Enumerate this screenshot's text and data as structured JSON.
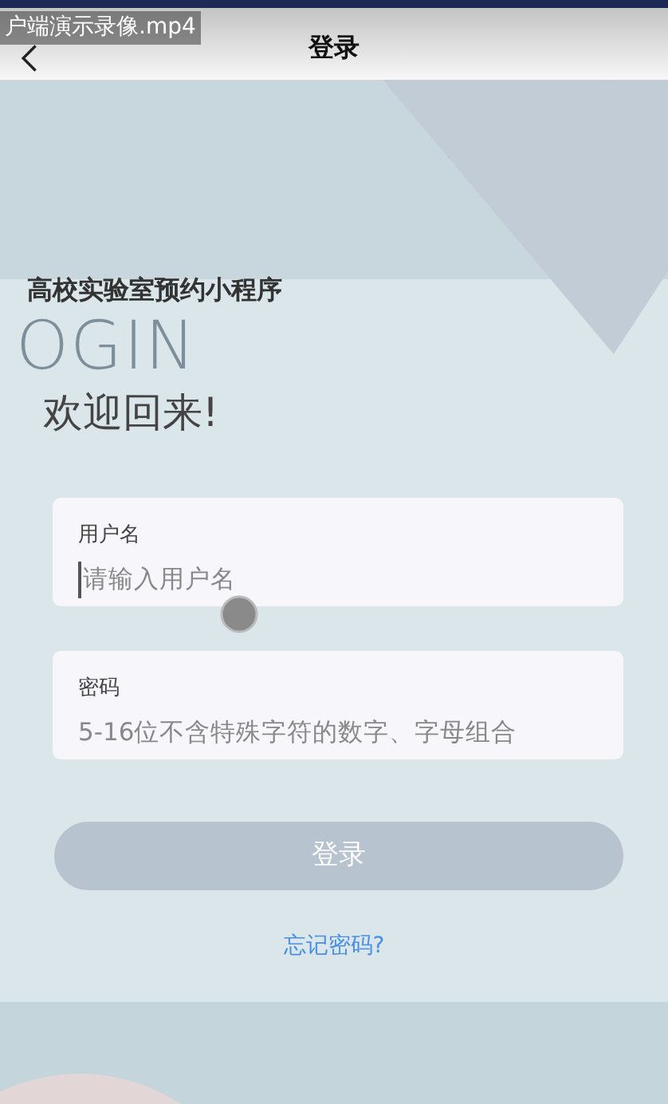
{
  "video_overlay": {
    "filename": "户端演示录像.mp4"
  },
  "nav": {
    "title": "登录"
  },
  "app_name": "高校实验室预约小程序",
  "backdrop_word": "OGIN",
  "welcome": "欢迎回来!",
  "fields": [
    {
      "label": "用户名",
      "placeholder": "请输入用户名",
      "focused": true
    },
    {
      "label": "密码",
      "placeholder": "5-16位不含特殊字符的数字、字母组合",
      "focused": false
    }
  ],
  "login_button": {
    "label": "登录",
    "disabled": true
  },
  "forgot_link": "忘记密码?"
}
